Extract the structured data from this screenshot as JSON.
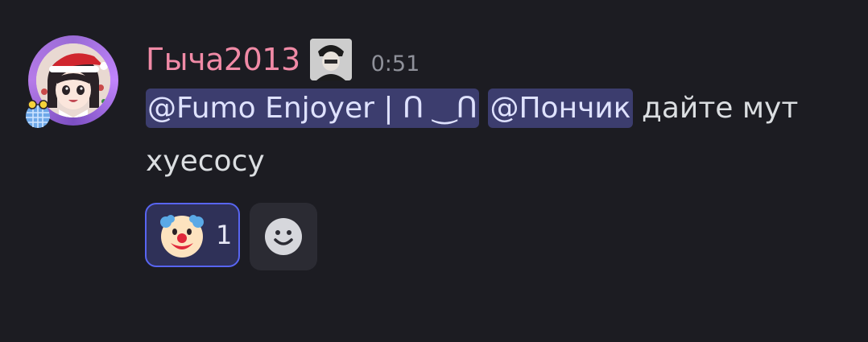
{
  "message": {
    "author": "Гыча2013",
    "timestamp": "0:51",
    "mentions": [
      "@Fumo Enjoyer | ꓵ ‿ꓵ",
      "@Пончик"
    ],
    "text_after_mentions": " дайте мут хуесосу"
  },
  "reactions": [
    {
      "emoji": "clown-face-icon",
      "count": "1",
      "selected": true
    }
  ],
  "add_reaction": {
    "icon": "smiley-add-reaction-icon"
  },
  "colors": {
    "background": "#1c1c22",
    "username": "#f08aa6",
    "mention_bg": "#3c3d6e",
    "reaction_border": "#5865f2",
    "timestamp": "#8f919a"
  }
}
